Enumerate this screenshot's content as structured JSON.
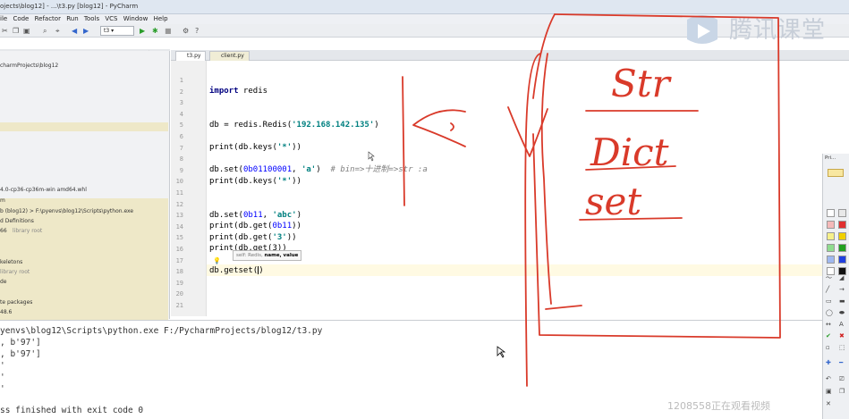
{
  "window": {
    "title": "ojects\\blog12] - ...\\t3.py [blog12] - PyCharm"
  },
  "menu": [
    "ile",
    "Code",
    "Refactor",
    "Run",
    "Tools",
    "VCS",
    "Window",
    "Help"
  ],
  "toolbar": {
    "run_config": "t3"
  },
  "project": {
    "path": "charmProjects\\blog12",
    "items": [
      "4.0-cp36-cp36m-win amd64.whl",
      "m",
      "b (blog12) > F:\\pyenvs\\blog12\\Scripts\\python.exe",
      "d Definitions",
      "66",
      "library root",
      "keletons",
      "library root",
      "de",
      "te packages",
      "48.6"
    ]
  },
  "tabs": [
    {
      "label": "t3.py"
    },
    {
      "label": "client.py"
    }
  ],
  "editor": {
    "line_numbers": [
      "1",
      "2",
      "3",
      "4",
      "5",
      "6",
      "7",
      "8",
      "9",
      "10",
      "11",
      "12",
      "13",
      "14",
      "15",
      "16",
      "17",
      "18",
      "19",
      "20",
      "21"
    ],
    "line_2": {
      "kw": "import",
      "rest": " redis"
    },
    "line_5": {
      "pre": "db = redis.Redis(",
      "str": "'192.168.142.135'",
      "post": ")"
    },
    "line_7": {
      "pre": "print(db.keys(",
      "str": "'*'",
      "post": "))"
    },
    "line_9": {
      "pre": "db.set(",
      "num": "0b01100001",
      "mid": ", ",
      "str": "'a'",
      "post": ")",
      "comment": "  # bin=>十进制=>str :a"
    },
    "line_10": {
      "pre": "print(db.keys(",
      "str": "'*'",
      "post": "))"
    },
    "line_13": {
      "pre": "db.set(",
      "num": "0b11",
      "mid": ", ",
      "str": "'abc'",
      "post": ")"
    },
    "line_14": {
      "pre": "print(db.get(",
      "num": "0b11",
      "post": "))"
    },
    "line_15": {
      "pre": "print(db.get(",
      "str": "'3'",
      "post": "))"
    },
    "line_16": {
      "text": "print(db.get(3))"
    },
    "line_18": {
      "pre": "db.getset(",
      "post": ")"
    },
    "tooltip": {
      "pre": "self: Redis, ",
      "bold": "name, value"
    }
  },
  "console": {
    "lines": [
      "yenvs\\blog12\\Scripts\\python.exe F:/PycharmProjects/blog12/t3.py",
      ", b'97']",
      ", b'97']",
      "'",
      "'",
      "'",
      "ss finished with exit code 0"
    ]
  },
  "brand": {
    "logo_text": "腾讯课堂"
  },
  "pen_panel": {
    "title": "Pri..."
  },
  "swatches": [
    "#ffffff",
    "#e8e8e8",
    "#f5b9b9",
    "#e03030",
    "#f6f08a",
    "#f0d000",
    "#8fdc8f",
    "#20a020",
    "#9fb8f0",
    "#2040e0",
    "#ffffff",
    "#111111"
  ],
  "handwriting": {
    "words": [
      "Str",
      "Dict",
      "set"
    ]
  },
  "watermark": {
    "text": "1208558正在观看视频"
  }
}
